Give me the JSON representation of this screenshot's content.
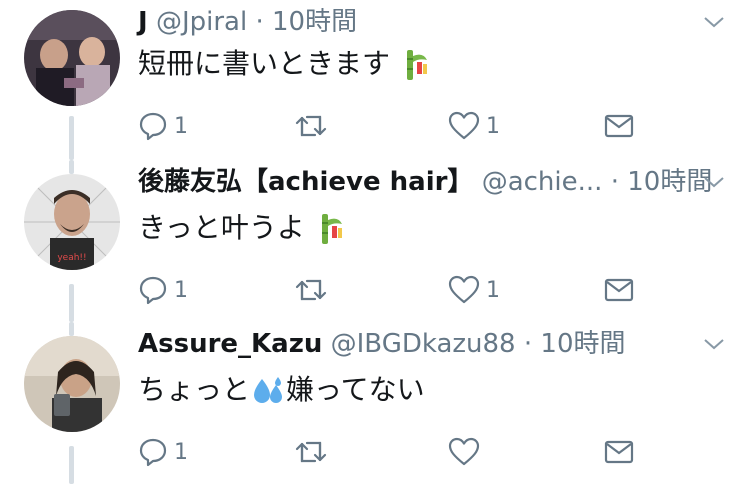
{
  "tweets": [
    {
      "name": "J",
      "handle": "@Jpiral",
      "separator": "·",
      "time": "10時間",
      "text": "短冊に書いときます",
      "emoji": "tanabata-tree",
      "replies": "1",
      "retweets": "",
      "likes": "1"
    },
    {
      "name": "後藤友弘【achieve hair】",
      "handle": "@achie...",
      "separator": "·",
      "time": "10時間",
      "text": "きっと叶うよ",
      "emoji": "tanabata-tree",
      "replies": "1",
      "retweets": "",
      "likes": "1"
    },
    {
      "name": "Assure_Kazu",
      "handle": "@IBGDkazu88",
      "separator": "·",
      "time": "10時間",
      "text_before": "ちょっと",
      "emoji": "sweat-droplets",
      "text_after": "嫌ってない",
      "replies": "1",
      "retweets": "",
      "likes": ""
    }
  ],
  "colors": {
    "text": "#14171a",
    "muted": "#657786",
    "line": "#d6dde3"
  }
}
